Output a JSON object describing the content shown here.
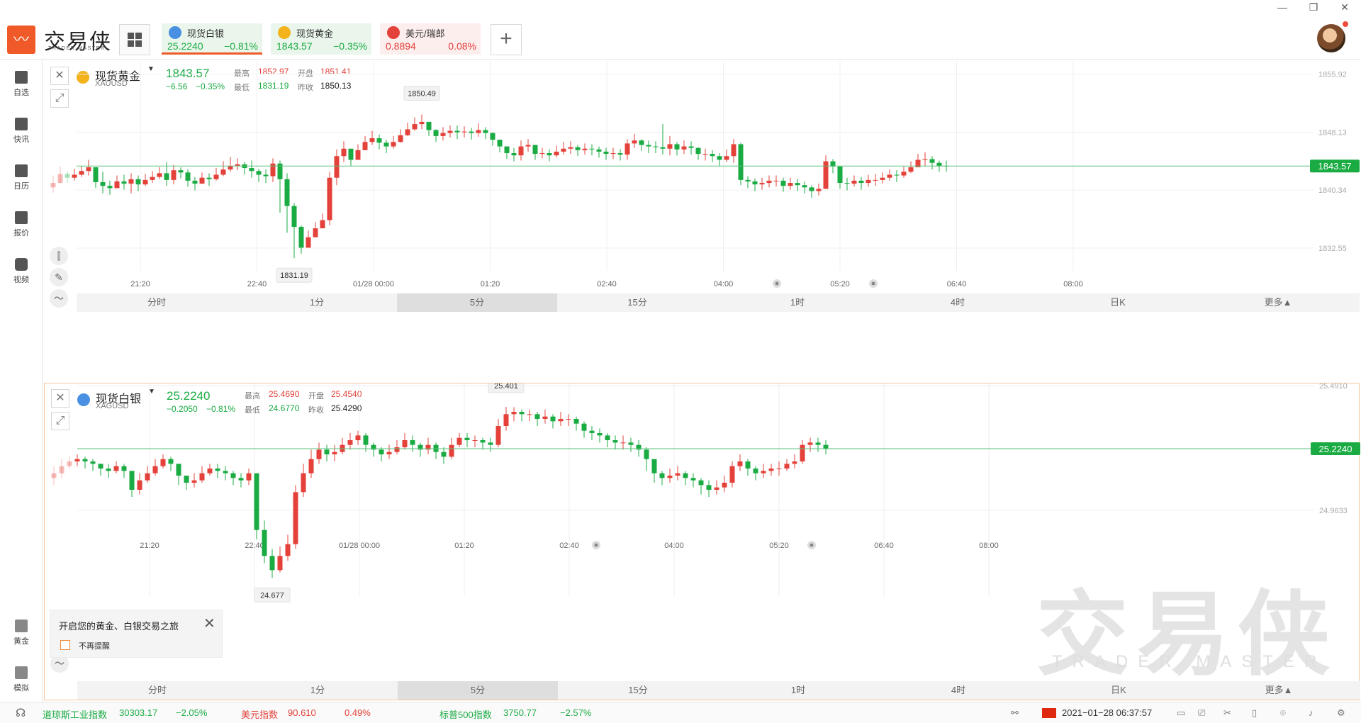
{
  "header": {
    "brand": "交易侠",
    "brand_sub": "TRADER MASTER",
    "tabs": [
      {
        "name": "现货白银",
        "price": "25.2240",
        "change": "−0.81%",
        "icon": "silver-coin-icon",
        "icon_color": "#4a90e2",
        "active": true,
        "trend": "down"
      },
      {
        "name": "现货黄金",
        "price": "1843.57",
        "change": "−0.35%",
        "icon": "gold-coin-icon",
        "icon_color": "#f2b31b",
        "active": false,
        "trend": "down"
      },
      {
        "name": "美元/瑞郎",
        "price": "0.8894",
        "change": "0.08%",
        "icon": "swiss-flag-icon",
        "icon_color": "#e3413a",
        "active": false,
        "trend": "up"
      }
    ],
    "add_label": "+",
    "window_controls": [
      "—",
      "❐",
      "✕"
    ]
  },
  "sidebar": {
    "items": [
      {
        "label": "自选",
        "icon": "bookmark-icon"
      },
      {
        "label": "快讯",
        "icon": "news-icon"
      },
      {
        "label": "日历",
        "icon": "calendar-icon"
      },
      {
        "label": "报价",
        "icon": "chart-line-icon"
      },
      {
        "label": "视频",
        "icon": "play-icon"
      }
    ],
    "bottom_items": [
      {
        "label": "黄金",
        "icon": "gold-bar-icon"
      },
      {
        "label": "模拟",
        "icon": "wallet-icon"
      }
    ]
  },
  "gold": {
    "name": "现货黄金",
    "symbol": "XAUUSD",
    "price": "1843.57",
    "change": "−6.56",
    "change_pct": "−0.35%",
    "high_label": "最高",
    "high": "1852.97",
    "open_label": "开盘",
    "open": "1851.41",
    "low_label": "最低",
    "low": "1831.19",
    "prev_label": "昨收",
    "prev": "1850.13",
    "peak_label": "1850.49",
    "trough_label": "1831.19",
    "price_tag": "1843.57",
    "y_ticks": [
      "1855.92",
      "1848.13",
      "1840.34",
      "1832.55"
    ],
    "x_ticks": [
      "21:20",
      "22:40",
      "01/28 00:00",
      "01:20",
      "02:40",
      "04:00",
      "05:20",
      "06:40",
      "08:00"
    ]
  },
  "silver": {
    "name": "现货白银",
    "symbol": "XAGUSD",
    "price": "25.2240",
    "change": "−0.2050",
    "change_pct": "−0.81%",
    "high_label": "最高",
    "high": "25.4690",
    "open_label": "开盘",
    "open": "25.4540",
    "low_label": "最低",
    "low": "24.6770",
    "prev_label": "昨收",
    "prev": "25.4290",
    "peak_label": "25.401",
    "trough_label": "24.677",
    "price_tag": "25.2240",
    "y_ticks": [
      "25.4910",
      "24.9633"
    ],
    "x_ticks": [
      "21:20",
      "22:40",
      "01/28 00:00",
      "01:20",
      "02:40",
      "04:00",
      "05:20",
      "06:40",
      "08:00"
    ]
  },
  "periods": [
    "分时",
    "1分",
    "5分",
    "15分",
    "1时",
    "4时",
    "日K",
    "更多▲"
  ],
  "active_period": "5分",
  "popup": {
    "text": "开启您的黄金、白银交易之旅",
    "checkbox_label": "不再提醒",
    "close": "✕"
  },
  "watermark": {
    "big": "交易侠",
    "small": "TRADER MASTER"
  },
  "statusbar": {
    "indices": [
      {
        "name": "道琼斯工业指数",
        "value": "30303.17",
        "change": "−2.05%"
      },
      {
        "name": "美元指数",
        "value": "90.610",
        "change": "0.49%"
      },
      {
        "name": "标普500指数",
        "value": "3750.77",
        "change": "−2.57%"
      }
    ],
    "datetime": "2021−01−28 06:37:57"
  },
  "colors": {
    "up": "#e3413a",
    "down": "#1aab43",
    "accent": "#f05a28"
  },
  "chart_data": [
    {
      "type": "candlestick",
      "title": "现货黄金",
      "ylim": [
        1829.5,
        1857.3
      ],
      "y_ticks": [
        1855.92,
        1848.13,
        1840.34,
        1832.55
      ],
      "last": 1843.57,
      "closes": [
        1841.3,
        1842.5,
        1842.0,
        1842.4,
        1842.9,
        1843.4,
        1841.4,
        1840.9,
        1840.6,
        1841.5,
        1841.2,
        1841.8,
        1841.1,
        1841.7,
        1842.1,
        1842.6,
        1841.7,
        1843.0,
        1842.7,
        1841.6,
        1841.2,
        1842.0,
        1841.8,
        1842.4,
        1843.1,
        1843.6,
        1843.8,
        1843.3,
        1842.9,
        1842.4,
        1842.2,
        1843.9,
        1841.8,
        1838.2,
        1835.4,
        1832.6,
        1834.0,
        1835.2,
        1836.3,
        1842.0,
        1844.9,
        1845.9,
        1844.4,
        1845.7,
        1846.8,
        1847.3,
        1846.7,
        1846.2,
        1846.8,
        1847.7,
        1848.5,
        1849.2,
        1849.5,
        1848.4,
        1847.6,
        1848.0,
        1848.3,
        1848.1,
        1848.2,
        1848.0,
        1848.4,
        1848.0,
        1847.1,
        1846.2,
        1845.3,
        1845.0,
        1846.2,
        1846.4,
        1845.2,
        1845.3,
        1845.0,
        1845.5,
        1845.9,
        1846.1,
        1845.7,
        1845.9,
        1845.8,
        1845.5,
        1845.2,
        1845.3,
        1845.1,
        1846.6,
        1847.0,
        1846.4,
        1846.2,
        1846.1,
        1845.9,
        1846.5,
        1845.8,
        1846.2,
        1846.0,
        1845.2,
        1845.2,
        1844.9,
        1844.4,
        1844.9,
        1846.5,
        1841.7,
        1841.5,
        1841.1,
        1841.3,
        1841.6,
        1841.6,
        1840.9,
        1841.3,
        1841.0,
        1840.7,
        1840.2,
        1840.5,
        1844.2,
        1843.5,
        1841.3,
        1841.2,
        1841.6,
        1841.3,
        1841.7,
        1841.7,
        1842.0,
        1842.4,
        1842.3,
        1842.8,
        1843.4,
        1844.4,
        1844.5,
        1844.0,
        1843.6,
        1843.57
      ],
      "highs": [
        1842.3,
        1843.5,
        1842.8,
        1843.2,
        1843.6,
        1844.4,
        1843.4,
        1842.8,
        1841.6,
        1842.3,
        1842.4,
        1842.6,
        1842.3,
        1842.5,
        1842.9,
        1843.4,
        1844.1,
        1843.7,
        1843.4,
        1843.1,
        1842.1,
        1842.7,
        1842.6,
        1843.3,
        1844.2,
        1844.8,
        1844.6,
        1844.1,
        1844.3,
        1843.2,
        1843.1,
        1844.6,
        1844.3,
        1842.6,
        1838.6,
        1835.6,
        1834.9,
        1836.0,
        1837.2,
        1842.8,
        1845.8,
        1846.9,
        1845.5,
        1846.5,
        1847.6,
        1848.3,
        1847.8,
        1847.1,
        1847.6,
        1848.5,
        1849.4,
        1850.1,
        1850.49,
        1849.5,
        1848.5,
        1848.8,
        1849.0,
        1849.0,
        1848.9,
        1848.7,
        1849.3,
        1848.8,
        1848.1,
        1847.0,
        1846.2,
        1846.0,
        1847.0,
        1847.2,
        1846.4,
        1846.0,
        1845.8,
        1846.3,
        1846.8,
        1846.9,
        1846.4,
        1846.6,
        1846.5,
        1846.2,
        1846.0,
        1846.0,
        1845.8,
        1847.2,
        1847.9,
        1847.2,
        1847.0,
        1846.9,
        1849.2,
        1847.6,
        1846.8,
        1847.0,
        1846.9,
        1846.1,
        1845.9,
        1845.7,
        1845.3,
        1845.8,
        1847.2,
        1846.7,
        1842.2,
        1841.9,
        1842.0,
        1842.3,
        1842.3,
        1842.0,
        1842.0,
        1841.8,
        1841.5,
        1841.0,
        1841.2,
        1845.0,
        1844.5,
        1842.5,
        1842.0,
        1842.3,
        1842.1,
        1842.4,
        1842.5,
        1842.7,
        1843.1,
        1843.0,
        1843.5,
        1844.2,
        1845.2,
        1845.4,
        1844.9,
        1844.3,
        1844.3
      ],
      "lows": [
        1840.0,
        1841.2,
        1841.3,
        1841.6,
        1842.1,
        1842.3,
        1840.6,
        1839.9,
        1839.7,
        1840.6,
        1840.4,
        1839.9,
        1840.2,
        1840.9,
        1841.3,
        1841.8,
        1840.9,
        1841.1,
        1841.9,
        1840.8,
        1840.3,
        1841.2,
        1840.9,
        1841.6,
        1842.2,
        1842.8,
        1843.0,
        1842.4,
        1842.0,
        1841.4,
        1841.3,
        1841.4,
        1837.3,
        1834.6,
        1831.19,
        1831.8,
        1832.9,
        1834.2,
        1835.4,
        1835.6,
        1841.0,
        1844.1,
        1843.6,
        1844.8,
        1845.9,
        1846.4,
        1845.8,
        1845.3,
        1845.9,
        1846.7,
        1847.6,
        1848.3,
        1848.5,
        1847.6,
        1846.8,
        1847.0,
        1847.4,
        1847.2,
        1847.4,
        1847.1,
        1847.5,
        1847.2,
        1846.3,
        1845.4,
        1844.5,
        1844.2,
        1844.3,
        1845.5,
        1844.4,
        1844.6,
        1844.2,
        1844.7,
        1845.1,
        1845.2,
        1844.9,
        1845.1,
        1845.0,
        1844.7,
        1844.4,
        1844.5,
        1844.3,
        1844.4,
        1846.0,
        1845.6,
        1845.3,
        1845.3,
        1845.1,
        1845.0,
        1845.0,
        1845.2,
        1845.1,
        1844.4,
        1844.3,
        1844.1,
        1843.6,
        1844.1,
        1844.0,
        1841.0,
        1840.6,
        1840.2,
        1840.4,
        1840.7,
        1840.8,
        1840.1,
        1840.4,
        1840.2,
        1839.9,
        1839.3,
        1839.6,
        1840.6,
        1842.6,
        1840.5,
        1840.3,
        1840.8,
        1840.4,
        1840.8,
        1840.9,
        1841.2,
        1841.6,
        1841.4,
        1842.0,
        1842.6,
        1843.4,
        1843.6,
        1843.1,
        1842.8,
        1842.8
      ]
    },
    {
      "type": "candlestick",
      "title": "现货白银",
      "ylim": [
        24.6,
        25.56
      ],
      "y_ticks": [
        25.491,
        24.9633
      ],
      "last": 25.224,
      "closes": [
        25.12,
        25.15,
        25.17,
        25.18,
        25.17,
        25.16,
        25.14,
        25.13,
        25.15,
        25.13,
        25.05,
        25.09,
        25.12,
        25.15,
        25.18,
        25.16,
        25.11,
        25.08,
        25.09,
        25.12,
        25.14,
        25.13,
        25.12,
        25.1,
        25.09,
        25.12,
        24.88,
        24.77,
        24.71,
        24.77,
        24.82,
        25.04,
        25.12,
        25.18,
        25.22,
        25.2,
        25.21,
        25.24,
        25.26,
        25.28,
        25.24,
        25.22,
        25.2,
        25.21,
        25.23,
        25.26,
        25.24,
        25.22,
        25.24,
        25.21,
        25.19,
        25.24,
        25.27,
        25.26,
        25.26,
        25.25,
        25.24,
        25.32,
        25.37,
        25.38,
        25.37,
        25.37,
        25.35,
        25.36,
        25.34,
        25.35,
        25.35,
        25.33,
        25.3,
        25.29,
        25.28,
        25.26,
        25.25,
        25.25,
        25.24,
        25.22,
        25.18,
        25.12,
        25.1,
        25.11,
        25.12,
        25.1,
        25.09,
        25.07,
        25.05,
        25.06,
        25.08,
        25.15,
        25.17,
        25.14,
        25.12,
        25.13,
        25.14,
        25.14,
        25.16,
        25.17,
        25.24,
        25.25,
        25.24,
        25.224
      ],
      "highs": [
        25.15,
        25.18,
        25.19,
        25.2,
        25.19,
        25.18,
        25.16,
        25.16,
        25.17,
        25.16,
        25.1,
        25.12,
        25.15,
        25.18,
        25.2,
        25.19,
        25.14,
        25.11,
        25.12,
        25.15,
        25.16,
        25.16,
        25.15,
        25.13,
        25.12,
        25.14,
        25.12,
        24.92,
        24.8,
        24.81,
        24.86,
        25.07,
        25.16,
        25.22,
        25.25,
        25.24,
        25.24,
        25.27,
        25.29,
        25.3,
        25.29,
        25.25,
        25.23,
        25.24,
        25.26,
        25.29,
        25.28,
        25.25,
        25.27,
        25.25,
        25.23,
        25.27,
        25.29,
        25.29,
        25.28,
        25.27,
        25.27,
        25.35,
        25.401,
        25.4,
        25.39,
        25.39,
        25.38,
        25.39,
        25.37,
        25.38,
        25.37,
        25.36,
        25.34,
        25.32,
        25.31,
        25.29,
        25.28,
        25.28,
        25.27,
        25.26,
        25.23,
        25.18,
        25.13,
        25.14,
        25.15,
        25.13,
        25.12,
        25.1,
        25.09,
        25.09,
        25.11,
        25.17,
        25.2,
        25.18,
        25.15,
        25.16,
        25.16,
        25.17,
        25.18,
        25.2,
        25.26,
        25.27,
        25.27,
        25.26
      ],
      "lows": [
        25.07,
        25.1,
        25.14,
        25.15,
        25.14,
        25.13,
        25.11,
        25.1,
        25.12,
        25.1,
        25.02,
        25.03,
        25.08,
        25.11,
        25.14,
        25.13,
        25.07,
        25.05,
        25.06,
        25.08,
        25.11,
        25.1,
        25.09,
        25.07,
        25.06,
        25.07,
        24.84,
        24.74,
        24.677,
        24.7,
        24.75,
        24.8,
        25.02,
        25.1,
        25.16,
        25.17,
        25.17,
        25.2,
        25.22,
        25.24,
        25.21,
        25.19,
        25.17,
        25.18,
        25.2,
        25.22,
        25.21,
        25.19,
        25.2,
        25.18,
        25.16,
        25.18,
        25.23,
        25.23,
        25.23,
        25.22,
        25.21,
        25.23,
        25.3,
        25.34,
        25.34,
        25.34,
        25.32,
        25.33,
        25.31,
        25.32,
        25.32,
        25.3,
        25.27,
        25.26,
        25.25,
        25.23,
        25.22,
        25.22,
        25.21,
        25.19,
        25.13,
        25.08,
        25.07,
        25.08,
        25.09,
        25.07,
        25.06,
        25.03,
        25.02,
        25.03,
        25.04,
        25.06,
        25.13,
        25.11,
        25.09,
        25.1,
        25.11,
        25.11,
        25.13,
        25.14,
        25.16,
        25.21,
        25.21,
        25.2
      ]
    }
  ]
}
